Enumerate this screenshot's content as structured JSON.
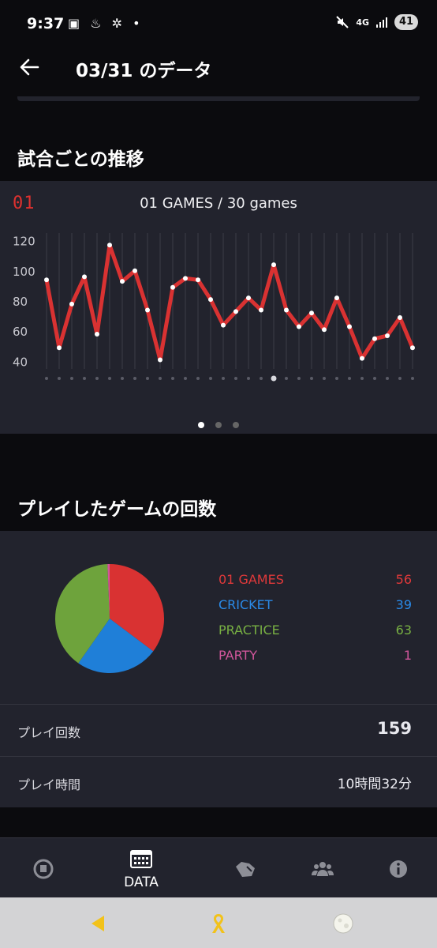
{
  "status_bar": {
    "time": "9:37",
    "left_icons": "▣ ♨ ✲ •",
    "network": "4G",
    "battery": "41"
  },
  "header": {
    "title": "03/31 のデータ",
    "back_icon": "arrow-left-icon"
  },
  "sections": {
    "trend_title": "試合ごとの推移",
    "count_title": "プレイしたゲームの回数"
  },
  "chart_data": [
    {
      "type": "line",
      "badge": "01",
      "title": "01 GAMES / 30 games",
      "yticks": [
        40,
        60,
        80,
        100,
        120
      ],
      "ylim": [
        35,
        125
      ],
      "x": [
        1,
        2,
        3,
        4,
        5,
        6,
        7,
        8,
        9,
        10,
        11,
        12,
        13,
        14,
        15,
        16,
        17,
        18,
        19,
        20,
        21,
        22,
        23,
        24,
        25,
        26,
        27,
        28,
        29,
        30
      ],
      "series": [
        {
          "values": [
            94,
            49,
            78,
            96,
            58,
            117,
            93,
            100,
            74,
            41,
            89,
            95,
            94,
            81,
            64,
            73,
            82,
            74,
            104,
            74,
            63,
            72,
            61,
            82,
            63,
            42,
            55,
            57,
            69,
            49
          ],
          "color": "#d93232"
        }
      ],
      "highlight_index": 18,
      "grid": true,
      "pager": {
        "count": 3,
        "active": 0
      }
    },
    {
      "type": "pie",
      "categories": [
        "01 GAMES",
        "CRICKET",
        "PRACTICE",
        "PARTY"
      ],
      "values": [
        56,
        39,
        63,
        1
      ],
      "colors": [
        "#d93232",
        "#1f7fd8",
        "#6ea33c",
        "#d0569b"
      ]
    }
  ],
  "legend": [
    {
      "name": "01 GAMES",
      "value": "56",
      "color": "#e0393a"
    },
    {
      "name": "CRICKET",
      "value": "39",
      "color": "#2a8ae8"
    },
    {
      "name": "PRACTICE",
      "value": "63",
      "color": "#78b043"
    },
    {
      "name": "PARTY",
      "value": "1",
      "color": "#d0569b"
    }
  ],
  "stats": {
    "plays_label": "プレイ回数",
    "plays_value": "159",
    "time_label": "プレイ時間",
    "time_value": "10時間32分"
  },
  "bottom_nav": {
    "items": [
      {
        "icon": "gauge-icon",
        "label": ""
      },
      {
        "icon": "calendar-grid-icon",
        "label": "DATA",
        "active": true
      },
      {
        "icon": "dart-board-icon",
        "label": ""
      },
      {
        "icon": "people-icon",
        "label": ""
      },
      {
        "icon": "info-icon",
        "label": ""
      }
    ]
  },
  "system_nav": {
    "items": [
      "back-triangle-icon",
      "ribbon-icon",
      "moon-icon"
    ]
  },
  "colors": {
    "background": "#0b0b0e",
    "card": "#22232d",
    "accent": "#d93232"
  }
}
